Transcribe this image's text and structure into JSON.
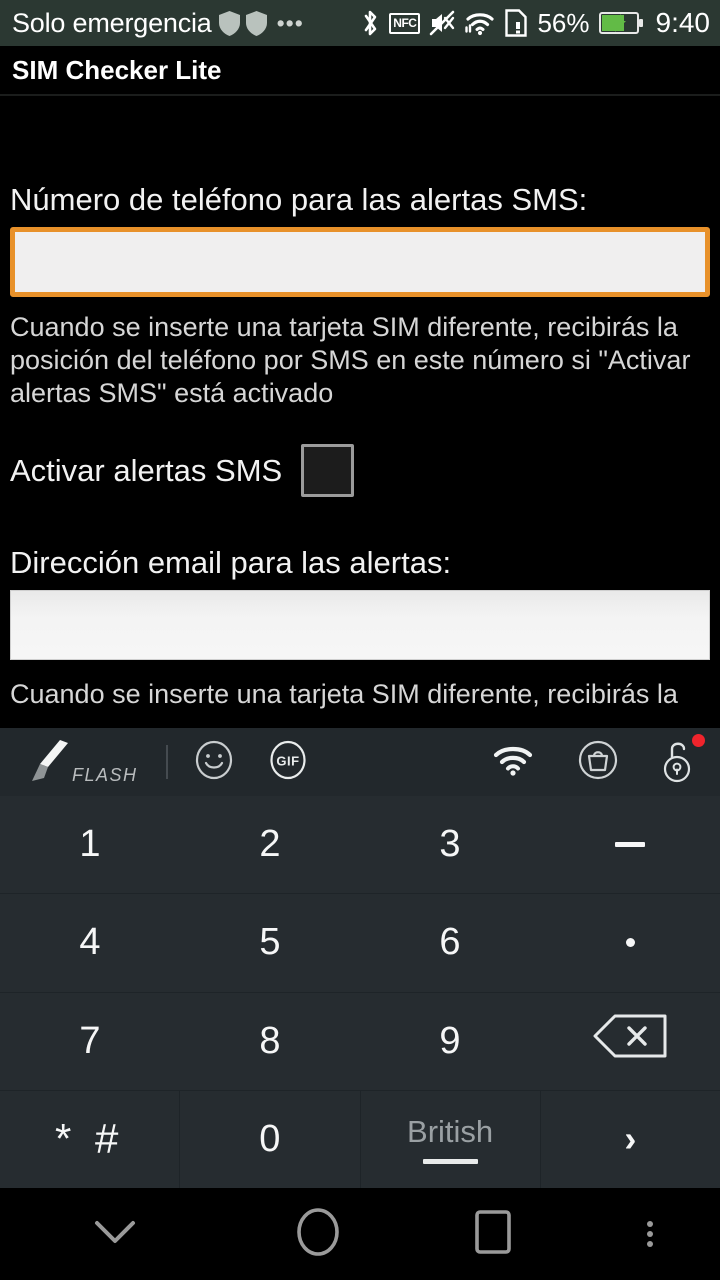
{
  "status_bar": {
    "carrier": "Solo emergencia",
    "icons": [
      "shield-icon",
      "shield-icon",
      "overflow-dots-icon",
      "bluetooth-icon",
      "nfc-icon",
      "mute-icon",
      "wifi-icon",
      "sim-alert-icon"
    ],
    "nfc_label": "NFC",
    "battery_percent": "56%",
    "time": "9:40",
    "background_color": "#2b3832",
    "battery_color": "#62bb46"
  },
  "title_bar": {
    "title": "SIM Checker Lite"
  },
  "app": {
    "phone_label": "Número de teléfono para las alertas SMS:",
    "phone_value": "",
    "phone_placeholder": "",
    "phone_helper": "Cuando se inserte una tarjeta SIM diferente, recibirás la posición del teléfono por SMS en este número si \"Activar alertas SMS\" está activado",
    "checkbox_label": "Activar alertas SMS",
    "checkbox_checked": false,
    "email_label": "Dirección email para las alertas:",
    "email_value": "",
    "email_placeholder": "",
    "email_helper": "Cuando se inserte una tarjeta SIM diferente, recibirás la",
    "focus_color": "#e8912a"
  },
  "keyboard": {
    "toolbar": {
      "brand": "FLASH",
      "left_icons": [
        "flash-quill-icon",
        "emoji-icon",
        "gif-icon"
      ],
      "right_icons": [
        "wifi-icon",
        "shopping-bag-icon",
        "unlock-icon"
      ],
      "notification_dot": true
    },
    "rows": [
      [
        {
          "name": "key-1",
          "label": "1",
          "type": "text"
        },
        {
          "name": "key-2",
          "label": "2",
          "type": "text"
        },
        {
          "name": "key-3",
          "label": "3",
          "type": "text"
        },
        {
          "name": "key-minus",
          "label": "–",
          "type": "minus"
        }
      ],
      [
        {
          "name": "key-4",
          "label": "4",
          "type": "text"
        },
        {
          "name": "key-5",
          "label": "5",
          "type": "text"
        },
        {
          "name": "key-6",
          "label": "6",
          "type": "text"
        },
        {
          "name": "key-period",
          "label": ".",
          "type": "dot"
        }
      ],
      [
        {
          "name": "key-7",
          "label": "7",
          "type": "text"
        },
        {
          "name": "key-8",
          "label": "8",
          "type": "text"
        },
        {
          "name": "key-9",
          "label": "9",
          "type": "text"
        },
        {
          "name": "key-backspace",
          "label": "",
          "type": "backspace"
        }
      ],
      [
        {
          "name": "key-star-hash",
          "label": "* #",
          "type": "starhash"
        },
        {
          "name": "key-0",
          "label": "0",
          "type": "text"
        },
        {
          "name": "key-language",
          "label": "British",
          "type": "lang"
        },
        {
          "name": "key-enter",
          "label": "›",
          "type": "chevron"
        }
      ]
    ],
    "background_color": "#262c30"
  },
  "nav_bar": {
    "items": [
      "hide-keyboard-icon",
      "home-icon",
      "recents-icon",
      "menu-icon"
    ]
  }
}
